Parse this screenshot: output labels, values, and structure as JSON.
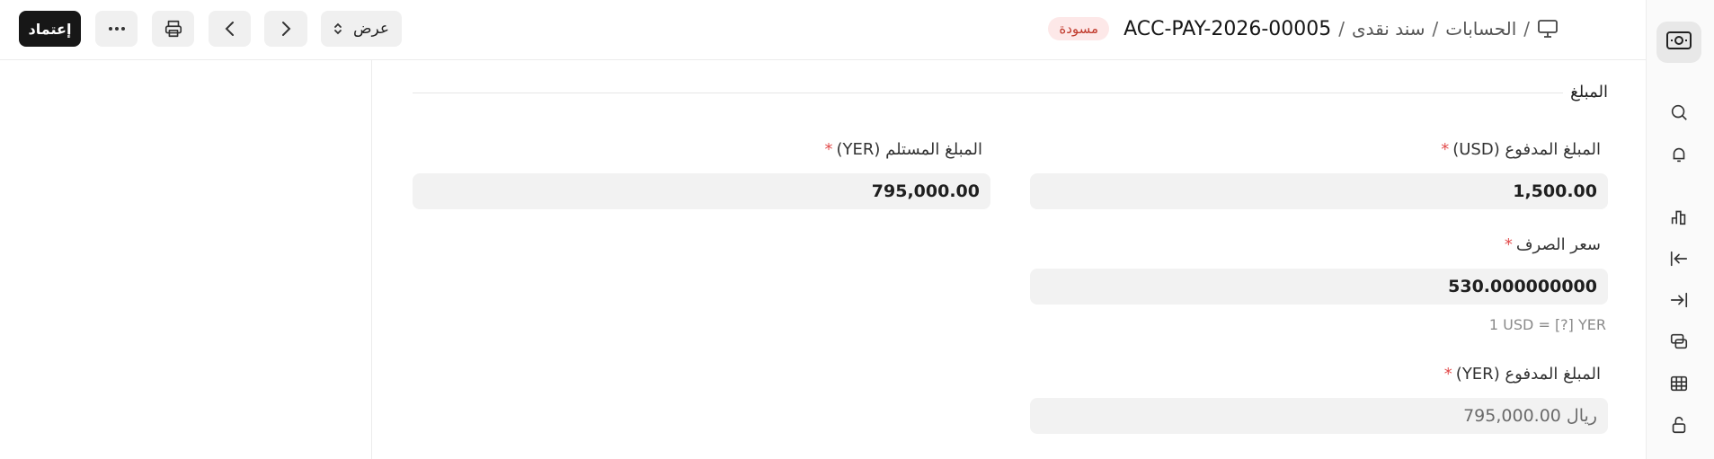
{
  "toolbar": {
    "submit_label": "إعتماد",
    "more_icon": "ellipsis-icon",
    "print_icon": "printer-icon",
    "prev_icon": "chevron-left-icon",
    "next_icon": "chevron-right-icon",
    "view_label": "عرض"
  },
  "breadcrumb": {
    "items": [
      "الحسابات",
      "سند نقدى"
    ],
    "separator": "/",
    "doc_name": "ACC-PAY-2026-00005",
    "status": "مسودة"
  },
  "section": {
    "title": "المبلغ"
  },
  "fields": {
    "paid_amount_usd": {
      "label": "المبلغ المدفوع (USD)",
      "value": "1,500.00"
    },
    "received_amount_yer": {
      "label": "المبلغ المستلم (YER)",
      "value": "795,000.00"
    },
    "exchange_rate": {
      "label": "سعر الصرف",
      "value": "530.000000000",
      "help": "1 USD = [?] YER"
    },
    "paid_amount_yer": {
      "label": "المبلغ المدفوع (YER)",
      "value": "ريال 795,000.00"
    },
    "required_marker": "*"
  },
  "colors": {
    "primary_button": "#171717",
    "status_badge_bg": "#fde8e8",
    "status_badge_text": "#c0392b",
    "required": "#e24c4c"
  }
}
